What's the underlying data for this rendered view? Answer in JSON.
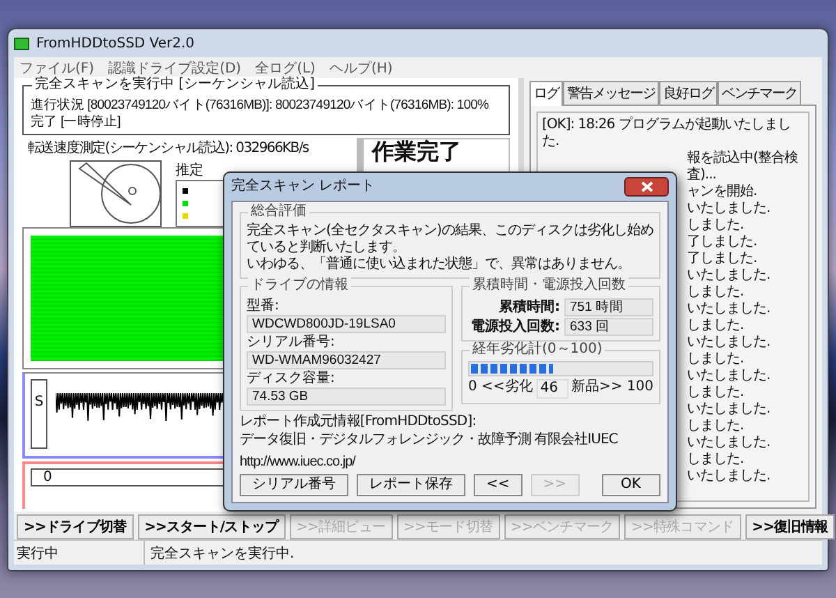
{
  "window": {
    "title": "FromHDDtoSSD Ver2.0"
  },
  "menu": [
    "ファイル(F)",
    "認識ドライブ設定(D)",
    "全ログ(L)",
    "ヘルプ(H)"
  ],
  "scan_group": {
    "title": "完全スキャンを実行中 [シーケンシャル読込]",
    "progress": "進行状況 [80023749120バイト(76316MB)]: 80023749120バイト(76316MB): 100%完了 [一時停止]"
  },
  "transfer_rate": "転送速度測定(シーケンシャル読込): 032966KB/s",
  "estimate_label": "推定",
  "legend": [
    {
      "color": "#000000"
    },
    {
      "color": "#00e000"
    },
    {
      "color": "#e8d800"
    }
  ],
  "status_panel": "作業完了",
  "graph": {
    "label": "S"
  },
  "timeline": {
    "label": "0"
  },
  "tabs": [
    {
      "label": "ログ",
      "selected": true
    },
    {
      "label": "警告メッセージ",
      "selected": false
    },
    {
      "label": "良好ログ",
      "selected": false
    },
    {
      "label": "ベンチマーク",
      "selected": false
    }
  ],
  "log": [
    {
      "kind": "full",
      "text": "[OK]: 18:26 プログラムが起動いたしました."
    },
    {
      "kind": "partial",
      "text": "報を読込中(整合検査)..."
    },
    {
      "kind": "partial",
      "text": "ャンを開始."
    },
    {
      "kind": "partial",
      "text": "いたしました."
    },
    {
      "kind": "partial",
      "text": "しました."
    },
    {
      "kind": "partial",
      "text": "了しました."
    },
    {
      "kind": "partial",
      "text": "了しました."
    },
    {
      "kind": "partial",
      "text": "いたしました."
    },
    {
      "kind": "partial",
      "text": "しました."
    },
    {
      "kind": "partial",
      "text": "いたしました."
    },
    {
      "kind": "partial",
      "text": "しました."
    },
    {
      "kind": "partial",
      "text": "いたしました."
    },
    {
      "kind": "partial",
      "text": "しました."
    },
    {
      "kind": "partial",
      "text": "いたしました."
    },
    {
      "kind": "partial",
      "text": "しました."
    },
    {
      "kind": "partial",
      "text": "いたしました."
    },
    {
      "kind": "partial",
      "text": "しました."
    },
    {
      "kind": "partial",
      "text": "いたしました."
    },
    {
      "kind": "partial",
      "text": "しました."
    },
    {
      "kind": "partial",
      "text": "いたしました."
    }
  ],
  "buttons": [
    {
      "label": ">>ドライブ切替",
      "disabled": false
    },
    {
      "label": ">>スタート/ストップ",
      "disabled": false
    },
    {
      "label": ">>詳細ビュー",
      "disabled": true
    },
    {
      "label": ">>モード切替",
      "disabled": true
    },
    {
      "label": ">>ベンチマーク",
      "disabled": true
    },
    {
      "label": ">>特殊コマンド",
      "disabled": true
    },
    {
      "label": ">>復旧情報",
      "disabled": false
    }
  ],
  "status_bar": {
    "state": "実行中",
    "message": "完全スキャンを実行中."
  },
  "dialog": {
    "title": "完全スキャン レポート",
    "overall": {
      "title": "総合評価",
      "lines": [
        "完全スキャン(全セクタスキャン)の結果、このディスクは劣化し始めていると判断いたします。",
        "いわゆる、「普通に使い込まれた状態」で、異常はありません。"
      ]
    },
    "drive_info": {
      "title": "ドライブの情報",
      "fields": [
        {
          "label": "型番:",
          "value": "WDCWD800JD-19LSA0"
        },
        {
          "label": "シリアル番号:",
          "value": "WD-WMAM96032427"
        },
        {
          "label": "ディスク容量:",
          "value": "74.53 GB"
        }
      ]
    },
    "usage": {
      "title": "累積時間・電源投入回数",
      "fields": [
        {
          "label": "累積時間:",
          "value": "751 時間"
        },
        {
          "label": "電源投入回数:",
          "value": "633 回"
        }
      ]
    },
    "aging": {
      "title": "経年劣化計(0～100)",
      "level": 0.46,
      "min_label": "0 <<劣化",
      "reading": "46",
      "max_label": "新品>> 100"
    },
    "source_label": "レポート作成元情報[FromHDDtoSSD]:",
    "source_text": "データ復旧・デジタルフォレンジック・故障予測 有限会社IUEC",
    "link": "http://www.iuec.co.jp/",
    "buttons": [
      {
        "label": "シリアル番号",
        "disabled": false
      },
      {
        "label": "レポート保存",
        "disabled": false
      },
      {
        "label": "<<",
        "disabled": false
      },
      {
        "label": ">>",
        "disabled": true
      },
      {
        "label": "OK",
        "disabled": false
      }
    ]
  }
}
